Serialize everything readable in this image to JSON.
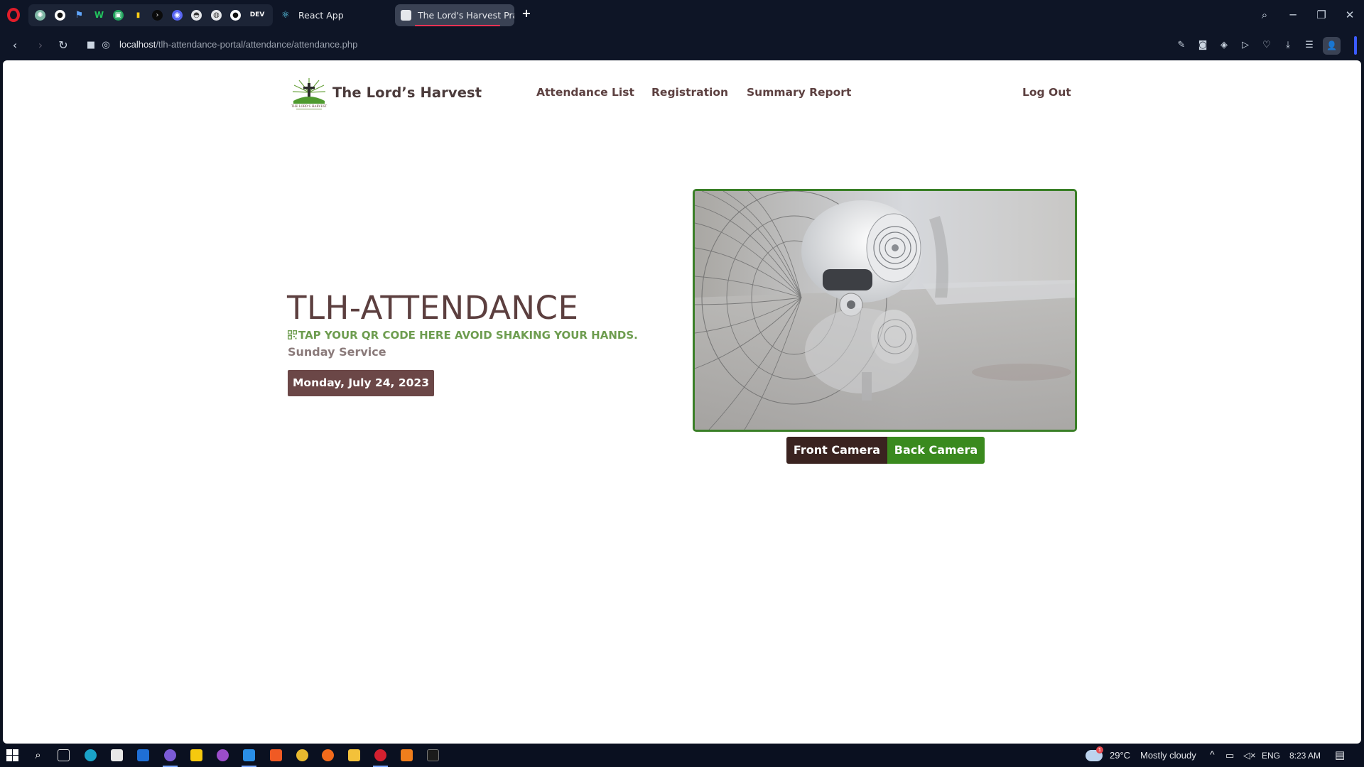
{
  "browser": {
    "tabs": [
      {
        "title": "React App"
      },
      {
        "title": "The Lord's Harvest Prayer"
      }
    ],
    "pinned_icons": [
      "chatgpt-icon",
      "github-icon",
      "flag-icon",
      "webflow-icon",
      "android-icon",
      "notes-icon",
      "terminal-icon",
      "discord-icon",
      "cloud-icon",
      "world-icon",
      "github-icon",
      "dev-icon"
    ],
    "pinned_dev_label": "DEV",
    "url": {
      "host": "localhost",
      "path": "/tlh-attendance-portal/attendance/attendance.php"
    }
  },
  "site": {
    "brand_name": "The Lord’s Harvest",
    "logo_text": "THE LORD'S HARVEST",
    "nav": {
      "attendance_list": "Attendance List",
      "registration": "Registration",
      "summary_report": "Summary Report",
      "logout": "Log Out"
    }
  },
  "main": {
    "title": "TLH-ATTENDANCE",
    "instruction": "TAP YOUR QR CODE HERE AVOID SHAKING YOUR HANDS.",
    "service": "Sunday Service",
    "date": "Monday, July 24, 2023"
  },
  "camera": {
    "front_label": "Front Camera",
    "back_label": "Back Camera"
  },
  "taskbar": {
    "weather_badge": "1",
    "temperature": "29°C",
    "weather": "Mostly cloudy",
    "language": "ENG",
    "time": "8:23 AM"
  },
  "colors": {
    "brand_brown": "#5c4040",
    "accent_green": "#3a8a1e",
    "instruction_green": "#6e9d50",
    "date_badge": "#6b4747",
    "front_camera": "#3a2320"
  }
}
